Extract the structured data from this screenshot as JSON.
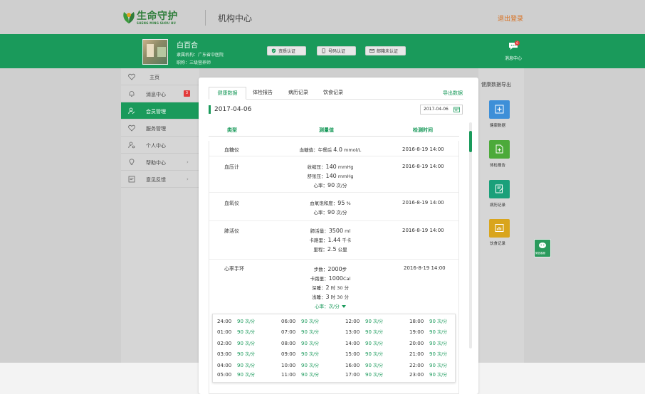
{
  "header": {
    "logo_cn": "生命守护",
    "logo_en": "SHENG MING SHOU HU",
    "title": "机构中心",
    "logout": "退出登录"
  },
  "user": {
    "name": "白百合",
    "org": "隶属机构：广东省中医院",
    "position": "职称：三级营养师"
  },
  "certs": [
    {
      "label": "资质认证",
      "icon": "shield-check-icon"
    },
    {
      "label": "号码认证",
      "icon": "phone-icon"
    },
    {
      "label": "邮箱未认证",
      "icon": "mail-icon"
    }
  ],
  "messages": {
    "label": "消息中心",
    "count": "6"
  },
  "sidebar": {
    "items": [
      {
        "label": "主页",
        "icon": "heart-icon"
      },
      {
        "label": "消息中心",
        "icon": "bell-icon",
        "badge": "3"
      },
      {
        "label": "会员管理",
        "icon": "user-edit-icon",
        "active": true
      },
      {
        "label": "服务管理",
        "icon": "heart-outline-icon"
      },
      {
        "label": "个人中心",
        "icon": "user-gear-icon"
      },
      {
        "label": "帮助中心",
        "icon": "bulb-icon",
        "chevron": true
      },
      {
        "label": "意见反馈",
        "icon": "feedback-icon",
        "chevron": true
      }
    ]
  },
  "right_panel": {
    "title": "健康数据导出",
    "tiles": [
      {
        "label": "健康数据",
        "color": "#3d8fd8",
        "icon": "plus-box-icon"
      },
      {
        "label": "体检报告",
        "color": "#4caa3a",
        "icon": "doc-plus-icon"
      },
      {
        "label": "病历记录",
        "color": "#1aa07a",
        "icon": "edit-doc-icon"
      },
      {
        "label": "饮食记录",
        "color": "#d9a51c",
        "icon": "chart-board-icon"
      }
    ],
    "wechat_label": "微信客服"
  },
  "card": {
    "tabs": [
      "健康数据",
      "体检报告",
      "病历记录",
      "饮食记录"
    ],
    "active_tab": 0,
    "export_label": "导出数据",
    "date_title": "2017-04-06",
    "date_value": "2017-04-06",
    "columns": {
      "type": "类型",
      "value": "测量值",
      "time": "检测时间"
    }
  },
  "records": [
    {
      "type": "血糖仪",
      "lines": [
        {
          "label": "血糖值：午餐后 ",
          "num": "4.0",
          "unit": " mmol/L"
        }
      ],
      "time": "2016-8-19  14:00"
    },
    {
      "type": "血压计",
      "lines": [
        {
          "label": "收缩压：",
          "num": "140",
          "unit": " mmHg"
        },
        {
          "label": "舒张压：",
          "num": "140",
          "unit": " mmHg"
        },
        {
          "label": "心率：",
          "num": "90",
          "unit": " 次/分"
        }
      ],
      "time": "2016-8-19  14:00"
    },
    {
      "type": "血氧仪",
      "lines": [
        {
          "label": "血氧饱和度：",
          "num": "95",
          "unit": " %"
        },
        {
          "label": "心率：",
          "num": "90",
          "unit": " 次/分"
        }
      ],
      "time": "2016-8-19  14:00"
    },
    {
      "type": "肺活仪",
      "lines": [
        {
          "label": "肺活量：",
          "num": "3500",
          "unit": " ml"
        },
        {
          "label": "卡路里：",
          "num": "1.44",
          "unit": " 千卡"
        },
        {
          "label": "里程：",
          "num": "2.5",
          "unit": " 公里"
        }
      ],
      "time": "2016-8-19  14:00"
    },
    {
      "type": "心率手环",
      "lines": [
        {
          "label": "步数：",
          "num": "2000",
          "unit": "步"
        },
        {
          "label": "卡路里：",
          "num": "1000",
          "unit": "Cal"
        },
        {
          "label": "深睡：",
          "num": "2",
          "unit": " 时 30 分"
        },
        {
          "label": "浅睡：",
          "num": "3",
          "unit": " 时 30 分"
        }
      ],
      "toggle": "心率：次/分",
      "time": "2016-8-19  14:00"
    }
  ],
  "heart_rate": {
    "value": "90",
    "unit": "次/分",
    "columns": [
      [
        "24:00",
        "01:00",
        "02:00",
        "03:00",
        "04:00",
        "05:00"
      ],
      [
        "06:00",
        "07:00",
        "08:00",
        "09:00",
        "10:00",
        "11:00"
      ],
      [
        "12:00",
        "13:00",
        "14:00",
        "15:00",
        "16:00",
        "17:00"
      ],
      [
        "18:00",
        "19:00",
        "20:00",
        "21:00",
        "22:00",
        "23:00"
      ]
    ]
  },
  "colors": {
    "brand": "#1a9a5b",
    "logout": "#d87020",
    "badge": "#e23b3b"
  }
}
